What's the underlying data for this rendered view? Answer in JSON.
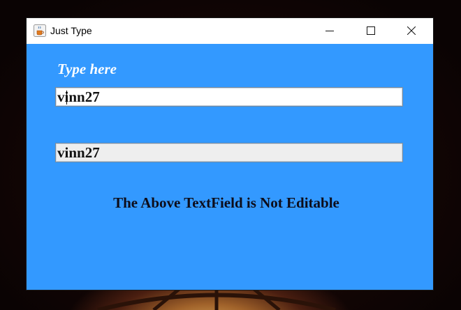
{
  "window": {
    "title": "Just Type",
    "app_icon": "java-cup-icon",
    "controls": [
      "minimize-icon",
      "maximize-icon",
      "close-icon"
    ]
  },
  "form": {
    "prompt_label": "Type here",
    "editable_field_value": "vinn27",
    "readonly_field_value": "vinn27",
    "notice_text": "The Above TextField is Not Editable"
  },
  "colors": {
    "content_background": "#3399ff",
    "label_text": "#ffffff",
    "readonly_field_background": "#eeeeee",
    "editable_field_background": "#ffffff"
  }
}
